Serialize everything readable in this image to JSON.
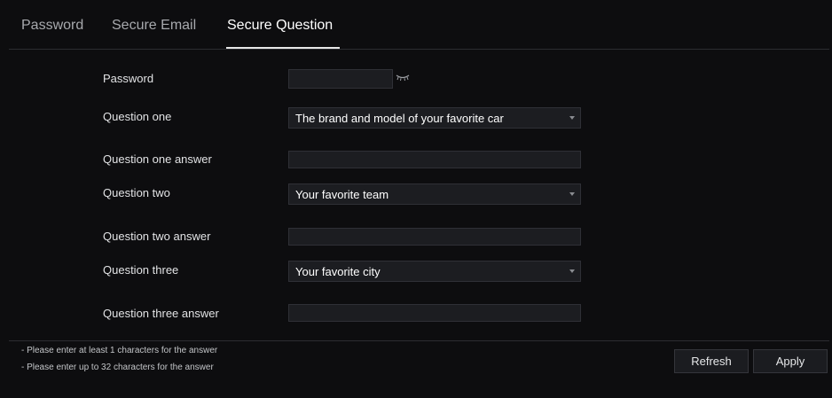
{
  "tabs": [
    {
      "label": "Password"
    },
    {
      "label": "Secure Email"
    },
    {
      "label": "Secure Question",
      "active": true
    }
  ],
  "form": {
    "password": {
      "label": "Password",
      "value": ""
    },
    "question_one": {
      "label": "Question one",
      "value": "The brand and model of your favorite car"
    },
    "answer_one": {
      "label": "Question one answer",
      "value": ""
    },
    "question_two": {
      "label": "Question two",
      "value": "Your favorite team"
    },
    "answer_two": {
      "label": "Question two answer",
      "value": ""
    },
    "question_three": {
      "label": "Question three",
      "value": "Your favorite city"
    },
    "answer_three": {
      "label": "Question three answer",
      "value": ""
    }
  },
  "notes": [
    "- Please enter at least 1 characters for the answer",
    "- Please enter up to 32 characters for the answer"
  ],
  "buttons": {
    "refresh": "Refresh",
    "apply": "Apply"
  },
  "icons": {
    "password_toggle": "eye-closed-icon",
    "dropdown": "caret-down-icon"
  },
  "colors": {
    "background": "#0d0d0f",
    "active_tab": "#ffffff",
    "inactive_tab": "#a7a9ad"
  }
}
